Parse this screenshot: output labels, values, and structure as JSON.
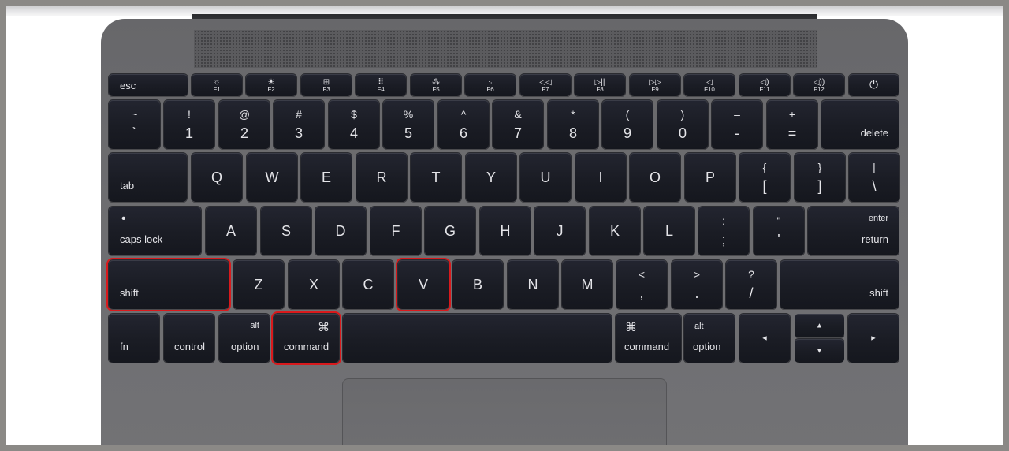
{
  "fkeys": [
    {
      "name": "esc-key",
      "label": "esc"
    },
    {
      "name": "f1-key",
      "label": "F1",
      "icon": "☼",
      "icon_name": "brightness-down-icon"
    },
    {
      "name": "f2-key",
      "label": "F2",
      "icon": "☀",
      "icon_name": "brightness-up-icon"
    },
    {
      "name": "f3-key",
      "label": "F3",
      "icon": "⊞",
      "icon_name": "mission-control-icon"
    },
    {
      "name": "f4-key",
      "label": "F4",
      "icon": "⠿",
      "icon_name": "launchpad-icon"
    },
    {
      "name": "f5-key",
      "label": "F5",
      "icon": "⁂",
      "icon_name": "keyboard-light-down-icon"
    },
    {
      "name": "f6-key",
      "label": "F6",
      "icon": "⁖",
      "icon_name": "keyboard-light-up-icon"
    },
    {
      "name": "f7-key",
      "label": "F7",
      "icon": "◁◁",
      "icon_name": "rewind-icon"
    },
    {
      "name": "f8-key",
      "label": "F8",
      "icon": "▷||",
      "icon_name": "play-pause-icon"
    },
    {
      "name": "f9-key",
      "label": "F9",
      "icon": "▷▷",
      "icon_name": "fast-forward-icon"
    },
    {
      "name": "f10-key",
      "label": "F10",
      "icon": "◁",
      "icon_name": "mute-icon"
    },
    {
      "name": "f11-key",
      "label": "F11",
      "icon": "◁)",
      "icon_name": "volume-down-icon"
    },
    {
      "name": "f12-key",
      "label": "F12",
      "icon": "◁))",
      "icon_name": "volume-up-icon"
    },
    {
      "name": "power-key",
      "icon": "⏻",
      "icon_name": "power-icon"
    }
  ],
  "number_row": [
    {
      "top": "~",
      "bottom": "`"
    },
    {
      "top": "!",
      "bottom": "1"
    },
    {
      "top": "@",
      "bottom": "2"
    },
    {
      "top": "#",
      "bottom": "3"
    },
    {
      "top": "$",
      "bottom": "4"
    },
    {
      "top": "%",
      "bottom": "5"
    },
    {
      "top": "^",
      "bottom": "6"
    },
    {
      "top": "&",
      "bottom": "7"
    },
    {
      "top": "*",
      "bottom": "8"
    },
    {
      "top": "(",
      "bottom": "9"
    },
    {
      "top": ")",
      "bottom": "0"
    },
    {
      "top": "–",
      "bottom": "-"
    },
    {
      "top": "+",
      "bottom": "="
    }
  ],
  "delete_label": "delete",
  "tab_label": "tab",
  "qwerty_row": [
    "Q",
    "W",
    "E",
    "R",
    "T",
    "Y",
    "U",
    "I",
    "O",
    "P"
  ],
  "bracket_keys": [
    {
      "top": "{",
      "bottom": "["
    },
    {
      "top": "}",
      "bottom": "]"
    },
    {
      "top": "|",
      "bottom": "\\"
    }
  ],
  "caps_lock_label": "caps lock",
  "caps_lock_indicator": "•",
  "home_row": [
    "A",
    "S",
    "D",
    "F",
    "G",
    "H",
    "J",
    "K",
    "L"
  ],
  "home_punct": [
    {
      "top": ":",
      "bottom": ";"
    },
    {
      "top": "\"",
      "bottom": "'"
    }
  ],
  "enter_label": "enter",
  "return_label": "return",
  "shift_label": "shift",
  "bottom_row_letters": [
    "Z",
    "X",
    "C",
    "V",
    "B",
    "N",
    "M"
  ],
  "bottom_punct": [
    {
      "top": "<",
      "bottom": ","
    },
    {
      "top": ">",
      "bottom": "."
    },
    {
      "top": "?",
      "bottom": "/"
    }
  ],
  "modifiers": {
    "fn": "fn",
    "control": "control",
    "alt": "alt",
    "option": "option",
    "command": "command",
    "command_symbol": "⌘"
  },
  "arrows": {
    "left": "◄",
    "right": "►",
    "up": "▲",
    "down": "▼"
  },
  "highlighted_keys": [
    "shift",
    "V",
    "command"
  ],
  "highlight_color": "#d9191c"
}
